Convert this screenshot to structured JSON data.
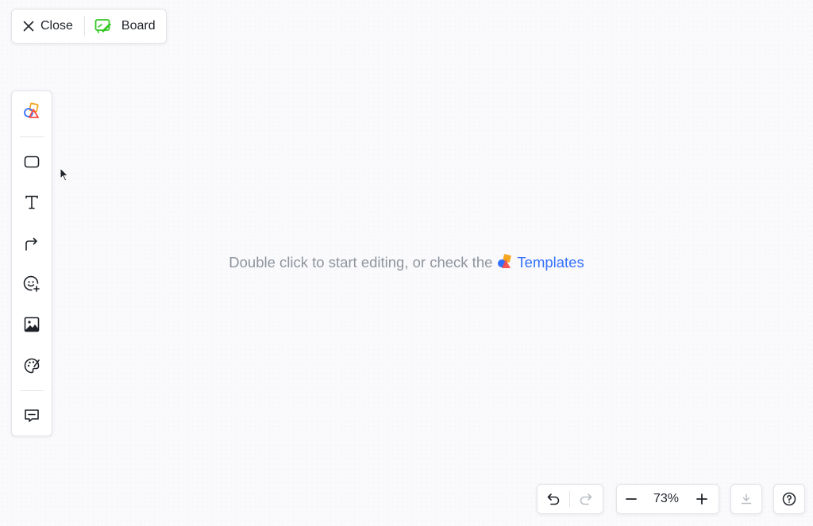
{
  "header": {
    "close_label": "Close",
    "board_label": "Board"
  },
  "toolbar": {
    "items": [
      "templates-icon",
      "rectangle-icon",
      "text-icon",
      "connector-icon",
      "sticker-icon",
      "image-icon",
      "palette-icon",
      "comment-icon"
    ]
  },
  "canvas": {
    "hint_text": "Double click to start editing, or check the",
    "templates_link": "Templates"
  },
  "zoom": {
    "value": "73%"
  },
  "colors": {
    "accent": "#3370ff",
    "board_green": "#34c724"
  }
}
